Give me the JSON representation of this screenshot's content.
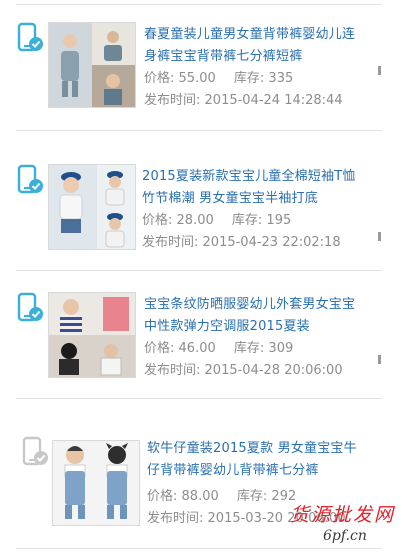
{
  "products": [
    {
      "title": "春夏童装儿童男女童背带裤婴幼儿连身裤宝宝背带裤七分裤短裤",
      "price_label": "价格:",
      "price": "55.00",
      "stock_label": "库存:",
      "stock": "335",
      "date_label": "发布时间:",
      "date": "2015-04-24 14:28:44",
      "status_icon": "mobile-check-icon"
    },
    {
      "title": "2015夏装新款宝宝儿童全棉短袖T恤竹节棉潮 男女童宝宝半袖打底",
      "price_label": "价格:",
      "price": "28.00",
      "stock_label": "库存:",
      "stock": "195",
      "date_label": "发布时间:",
      "date": "2015-04-23 22:02:18",
      "status_icon": "mobile-check-icon"
    },
    {
      "title": "宝宝条纹防晒服婴幼儿外套男女宝宝中性款弹力空调服2015夏装",
      "price_label": "价格:",
      "price": "46.00",
      "stock_label": "库存:",
      "stock": "309",
      "date_label": "发布时间:",
      "date": "2015-04-28 20:06:00",
      "status_icon": "mobile-check-icon"
    },
    {
      "title": "软牛仔童装2015夏款 男女童宝宝牛仔背带裤婴幼儿背带裤七分裤",
      "price_label": "价格:",
      "price": "88.00",
      "stock_label": "库存:",
      "stock": "292",
      "date_label": "发布时间:",
      "date": "2015-03-20 20:06:00",
      "status_icon": "mobile-check-icon-disabled"
    }
  ],
  "watermark": {
    "brand": "货源批发网",
    "site": "6pf.cn"
  },
  "colors": {
    "title": "#2a6fb0",
    "icon_active": "#3ab0d8",
    "icon_disabled": "#c8c8c8",
    "meta": "#8d8d8d",
    "watermark": "#e4212b"
  }
}
